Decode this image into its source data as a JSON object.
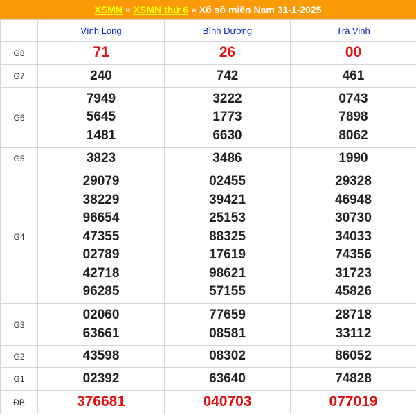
{
  "banner": {
    "link1": "XSMN",
    "sep1": "»",
    "link2": "XSMN thứ 6",
    "sep2": "»",
    "title": "Xổ số miền Nam 31-1-2025"
  },
  "provinces": [
    "Vĩnh Long",
    "Bình Dương",
    "Trà Vinh"
  ],
  "prizes": [
    {
      "label": "G8",
      "values": [
        [
          "71"
        ],
        [
          "26"
        ],
        [
          "00"
        ]
      ],
      "highlight": true
    },
    {
      "label": "G7",
      "values": [
        [
          "240"
        ],
        [
          "742"
        ],
        [
          "461"
        ]
      ]
    },
    {
      "label": "G6",
      "values": [
        [
          "7949",
          "5645",
          "1481"
        ],
        [
          "3222",
          "1773",
          "6630"
        ],
        [
          "0743",
          "7898",
          "8062"
        ]
      ]
    },
    {
      "label": "G5",
      "values": [
        [
          "3823"
        ],
        [
          "3486"
        ],
        [
          "1990"
        ]
      ]
    },
    {
      "label": "G4",
      "values": [
        [
          "29079",
          "38229",
          "96654",
          "47355",
          "02789",
          "42718",
          "96285"
        ],
        [
          "02455",
          "39421",
          "25153",
          "88325",
          "17619",
          "98621",
          "57155"
        ],
        [
          "29328",
          "46948",
          "30730",
          "34033",
          "74356",
          "31723",
          "45826"
        ]
      ]
    },
    {
      "label": "G3",
      "values": [
        [
          "02060",
          "63661"
        ],
        [
          "77659",
          "08581"
        ],
        [
          "28718",
          "33112"
        ]
      ]
    },
    {
      "label": "G2",
      "values": [
        [
          "43598"
        ],
        [
          "08302"
        ],
        [
          "86052"
        ]
      ]
    },
    {
      "label": "G1",
      "values": [
        [
          "02392"
        ],
        [
          "63640"
        ],
        [
          "74828"
        ]
      ]
    },
    {
      "label": "ĐB",
      "values": [
        [
          "376681"
        ],
        [
          "040703"
        ],
        [
          "077019"
        ]
      ],
      "highlight": true
    }
  ],
  "colors": {
    "banner_bg": "#fb9a07",
    "link_yellow": "#ffff00",
    "province_link": "#0b22c7",
    "highlight_red": "#e01111"
  }
}
